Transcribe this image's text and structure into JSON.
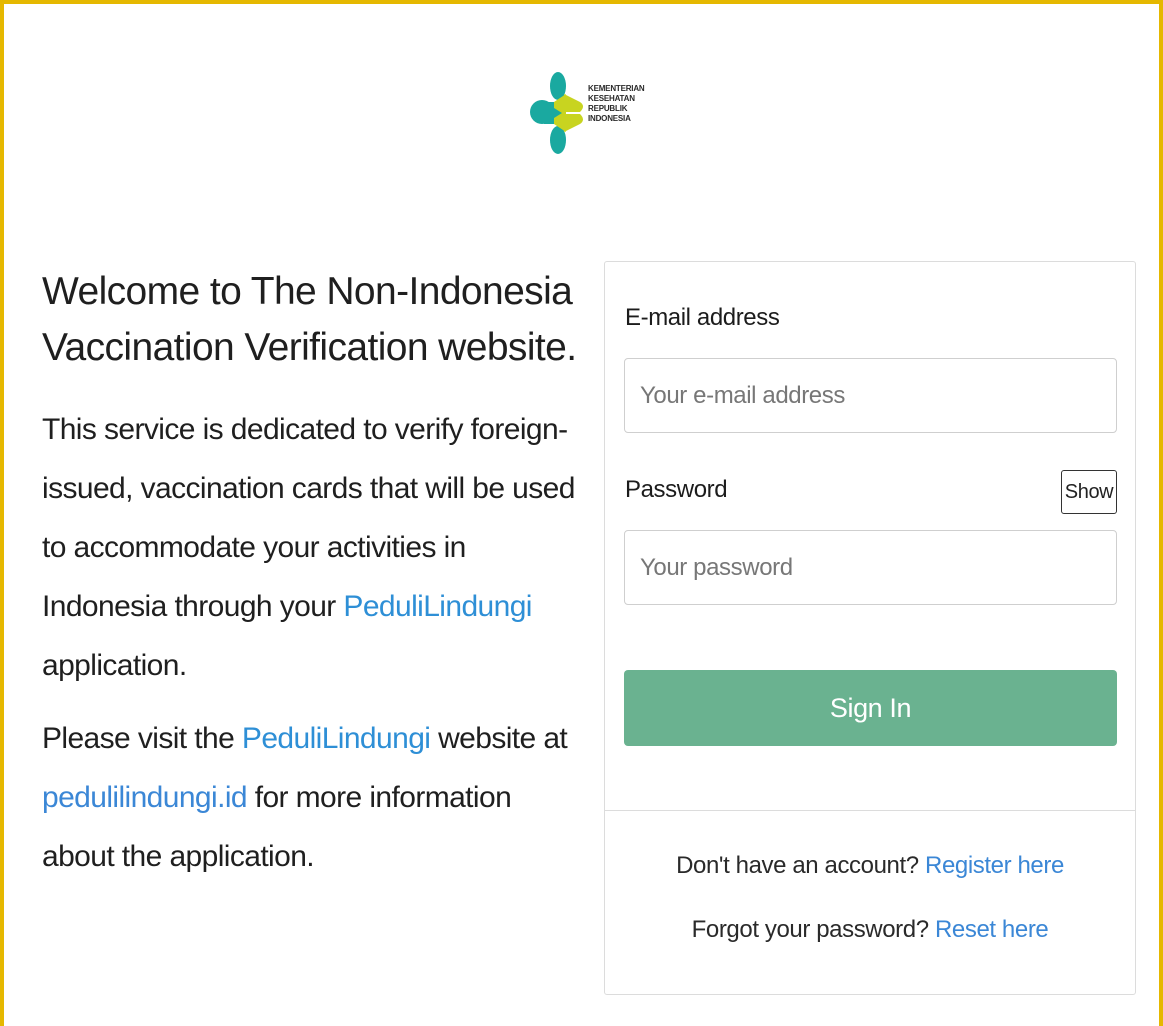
{
  "logo": {
    "lines": [
      "KEMENTERIAN",
      "KESEHATAN",
      "REPUBLIK",
      "INDONESIA"
    ],
    "colors": {
      "teal": "#1aa9a0",
      "lime": "#c8d420"
    }
  },
  "intro": {
    "heading": "Welcome to The Non-Indonesia Vaccination Verification website.",
    "para1_before": "This service is dedicated to verify foreign-issued, vaccination cards that will be used to accommodate your activities in Indonesia through your ",
    "para1_brand": "PeduliLindungi",
    "para1_after": " application.",
    "para2_before": "Please visit the ",
    "para2_brand": "PeduliLindungi",
    "para2_middle": " website at ",
    "para2_link": "pedulilindungi.id",
    "para2_after": " for more information about the application."
  },
  "form": {
    "email_label": "E-mail address",
    "email_placeholder": "Your e-mail address",
    "password_label": "Password",
    "password_placeholder": "Your password",
    "show_label": "Show",
    "signin_label": "Sign In"
  },
  "footer": {
    "register_prompt": "Don't have an account?",
    "register_link": "Register here",
    "reset_prompt": "Forgot your password?",
    "reset_link": "Reset here"
  },
  "colors": {
    "frame_border": "#e5b800",
    "signin_button": "#6ab290",
    "link": "#3b87d6",
    "brand": "#2e8fd6"
  }
}
